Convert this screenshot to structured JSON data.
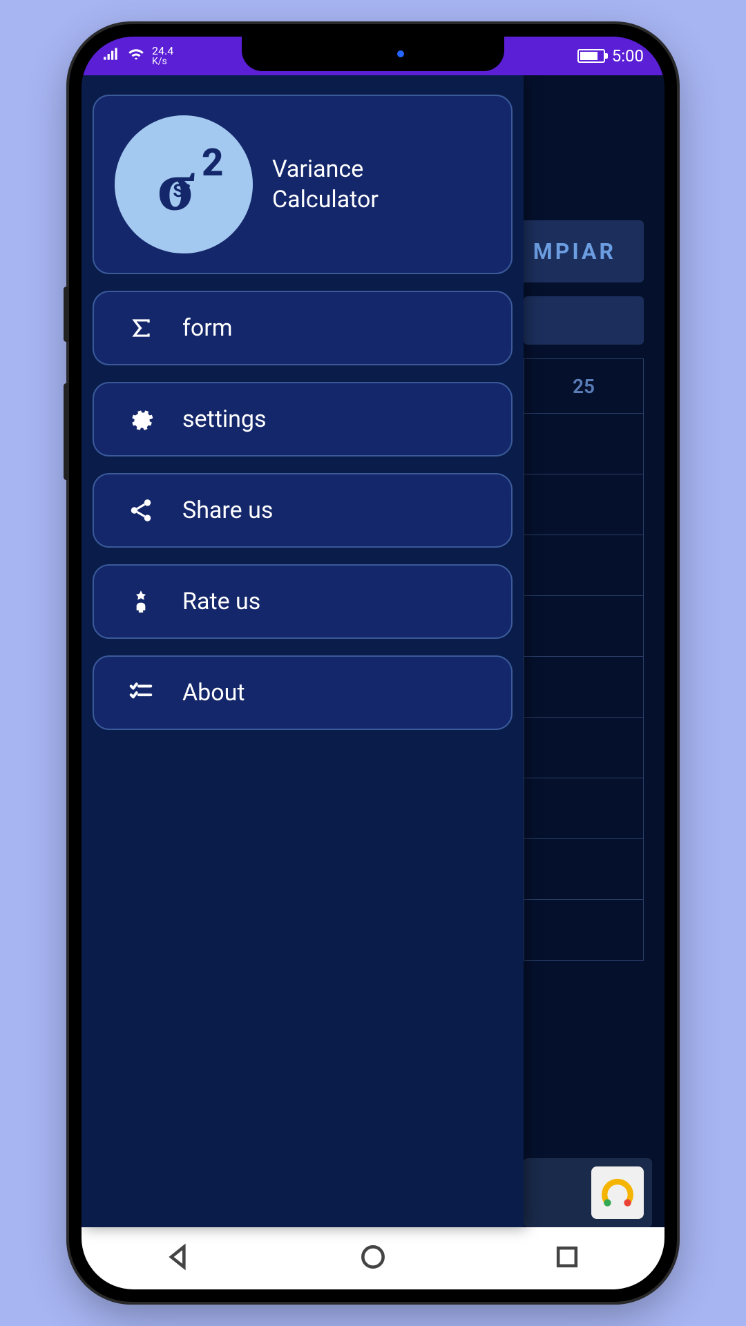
{
  "statusbar": {
    "speed_value": "24.4",
    "speed_unit": "K/s",
    "time": "5:00"
  },
  "app": {
    "title_line1": "Variance",
    "title_line2": "Calculator"
  },
  "menu": [
    {
      "label": "form"
    },
    {
      "label": "settings"
    },
    {
      "label": "Share us"
    },
    {
      "label": "Rate us"
    },
    {
      "label": "About"
    }
  ],
  "background": {
    "button_label": "MPIAR",
    "column_header": "25"
  }
}
